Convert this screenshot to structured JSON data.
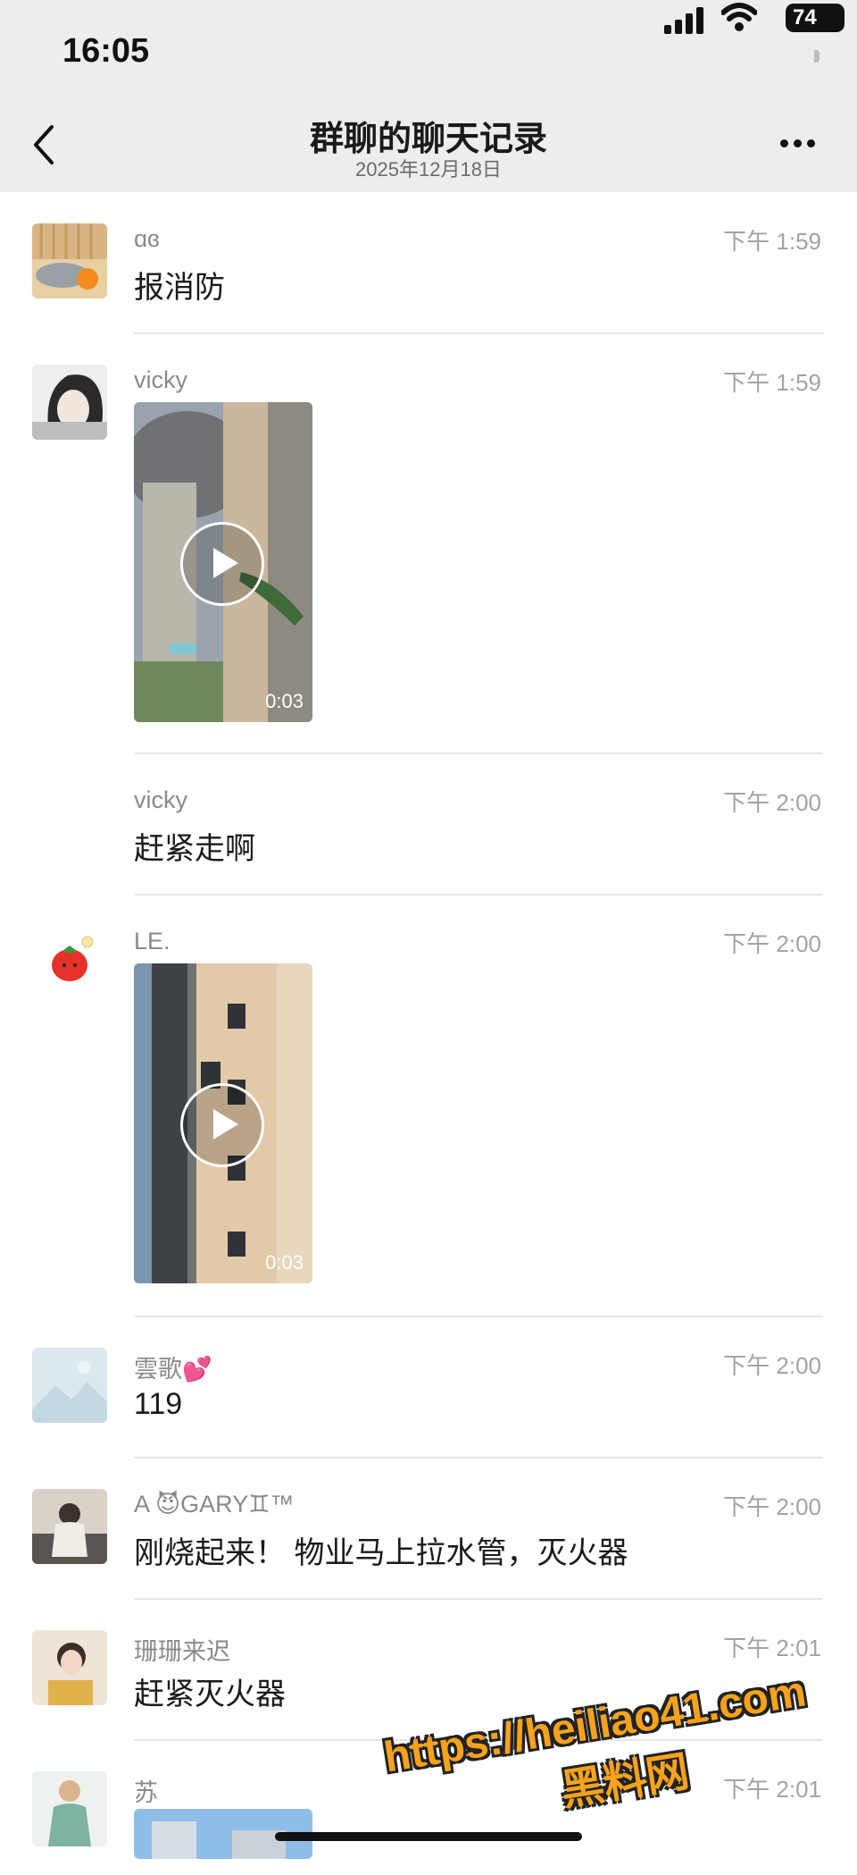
{
  "status_bar": {
    "time": "16:05",
    "battery": "74"
  },
  "nav": {
    "title": "群聊的聊天记录",
    "subtitle": "2025年12月18日"
  },
  "messages": [
    {
      "sender": "ɑɞ",
      "time": "下午 1:59",
      "text": "报消防"
    },
    {
      "sender": "vicky",
      "time": "下午 1:59",
      "video_duration": "0:03"
    },
    {
      "sender": "vicky",
      "time": "下午 2:00",
      "text": "赶紧走啊"
    },
    {
      "sender": "LE.",
      "time": "下午 2:00",
      "video_duration": "0:03"
    },
    {
      "sender": "雲歌💕",
      "time": "下午 2:00",
      "text": "119"
    },
    {
      "sender": "A   😈GARY♊™",
      "time": "下午 2:00",
      "text": "刚烧起来！ 物业马上拉水管，灭火器"
    },
    {
      "sender": "珊珊来迟",
      "time": "下午 2:01",
      "text": "赶紧灭火器"
    },
    {
      "sender": "苏",
      "time": "下午 2:01"
    }
  ],
  "watermark": {
    "line1": "https://heiliao41.com",
    "line2": "黑料网"
  },
  "colors": {
    "nav_bg": "#ededed",
    "watermark": "#f7a21b"
  }
}
